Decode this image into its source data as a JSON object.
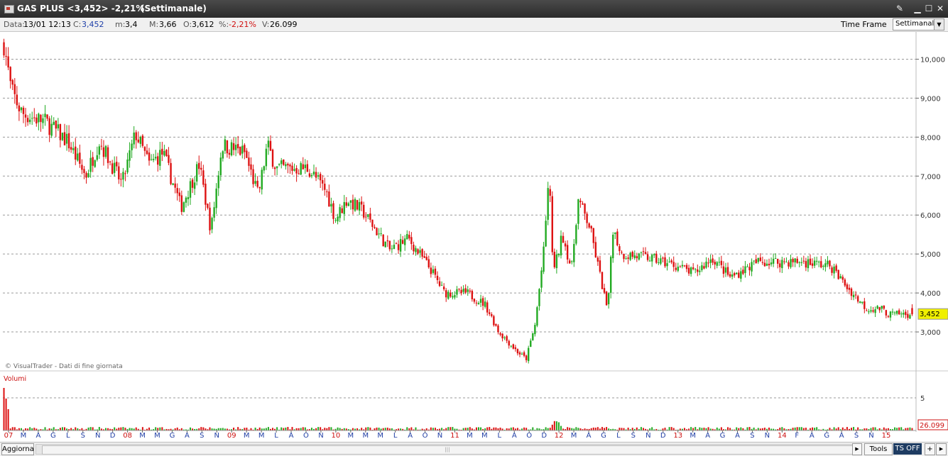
{
  "window": {
    "title": "GAS PLUS <3,452> -2,21%",
    "timeframe_label": "(Settimanale)",
    "controls": [
      "tool-icon",
      "minimize-icon",
      "maximize-icon",
      "close-icon"
    ]
  },
  "infobar": {
    "data_label": "Data:",
    "data_value": "13/01 12:13",
    "c_label": "C:",
    "c_value": "3,452",
    "m_label": "m:",
    "m_value": "3,4",
    "mx_label": "M:",
    "mx_value": "3,66",
    "o_label": "O:",
    "o_value": "3,612",
    "pct_label": "%:",
    "pct_value": "-2,21%",
    "v_label": "V:",
    "v_value": "26.099",
    "time_frame_label": "Time Frame",
    "time_frame_value": "Settimanale"
  },
  "statusbar": {
    "aggiorna": "Aggiorna",
    "tools": "Tools",
    "ts_off": "TS OFF",
    "plus": "+",
    "arrow": "▶"
  },
  "chart_data": {
    "type": "candlestick",
    "price_panel": {
      "yticks": [
        "3,000",
        "4,000",
        "5,000",
        "6,000",
        "7,000",
        "8,000",
        "9,000",
        "10,000"
      ],
      "ytick_values": [
        3,
        4,
        5,
        6,
        7,
        8,
        9,
        10
      ],
      "ylim": [
        2.0,
        10.7
      ],
      "grid": true,
      "last_price_label": "3,452",
      "last_price": 3.452,
      "source_note": "© VisualTrader - Dati di fine giornata"
    },
    "volume_panel": {
      "title": "Volumi",
      "ytick_label": "5",
      "ytick_value": 5,
      "last_volume_label": "26.099"
    },
    "xaxis": {
      "num_bars": 420,
      "labels": [
        {
          "bar": 3,
          "text": "07",
          "year": true
        },
        {
          "bar": 13,
          "text": "M"
        },
        {
          "bar": 22,
          "text": "A"
        },
        {
          "bar": 30,
          "text": "M"
        },
        {
          "bar": 40,
          "text": "G"
        },
        {
          "bar": 48,
          "text": "L"
        },
        {
          "bar": 57,
          "text": "A"
        },
        {
          "bar": 66,
          "text": "S"
        },
        {
          "bar": 74,
          "text": "O"
        },
        {
          "bar": 83,
          "text": "N"
        },
        {
          "bar": 91,
          "text": "D"
        },
        {
          "bar": 96,
          "text": "08",
          "year": true
        },
        {
          "bar": 109,
          "text": "M"
        },
        {
          "bar": 117,
          "text": "A"
        },
        {
          "bar": 126,
          "text": "M"
        },
        {
          "bar": 134,
          "text": "G"
        },
        {
          "bar": 143,
          "text": "L"
        },
        {
          "bar": 151,
          "text": "A"
        },
        {
          "bar": 160,
          "text": "S"
        },
        {
          "bar": 168,
          "text": "O"
        },
        {
          "bar": 177,
          "text": "N"
        },
        {
          "bar": 185,
          "text": "D"
        },
        {
          "bar": 191,
          "text": "09",
          "year": true
        },
        {
          "bar": 203,
          "text": "M"
        },
        {
          "bar": 212,
          "text": "A"
        },
        {
          "bar": 220,
          "text": "M"
        },
        {
          "bar": 229,
          "text": "G"
        },
        {
          "bar": 237,
          "text": "L"
        },
        {
          "bar": 246,
          "text": "A"
        },
        {
          "bar": 254,
          "text": "S"
        },
        {
          "bar": 263,
          "text": "O"
        },
        {
          "bar": 271,
          "text": "N"
        },
        {
          "bar": 280,
          "text": "D"
        },
        {
          "bar": 285,
          "text": "10",
          "year": true
        },
        {
          "bar": 297,
          "text": "M"
        },
        {
          "bar": 306,
          "text": "A"
        },
        {
          "bar": 314,
          "text": "M"
        },
        {
          "bar": 323,
          "text": "G"
        },
        {
          "bar": 331,
          "text": "L"
        },
        {
          "bar": 340,
          "text": "A"
        },
        {
          "bar": 348,
          "text": "S"
        },
        {
          "bar": 357,
          "text": "O"
        },
        {
          "bar": 365,
          "text": "N"
        },
        {
          "bar": 374,
          "text": "D"
        },
        {
          "bar": 379,
          "text": "11",
          "year": true
        },
        {
          "bar": 391,
          "text": "M"
        },
        {
          "bar": 400,
          "text": "A"
        },
        {
          "bar": 408,
          "text": "M"
        },
        {
          "bar": 416,
          "text": "G"
        }
      ],
      "visible_labels_text": "07 M A G L S N D 08 M M G A S N 09 M M L A O N 10 M M M L A O N 11 M M L A O D 12 M A G L S N D 13 M A G A S N 14 F A G A S N 15"
    },
    "price_series_anchors": [
      {
        "t": 0.0,
        "v": 10.4
      },
      {
        "t": 0.008,
        "v": 9.2
      },
      {
        "t": 0.02,
        "v": 8.6
      },
      {
        "t": 0.045,
        "v": 8.4
      },
      {
        "t": 0.07,
        "v": 7.9
      },
      {
        "t": 0.09,
        "v": 7.0
      },
      {
        "t": 0.105,
        "v": 7.9
      },
      {
        "t": 0.13,
        "v": 6.8
      },
      {
        "t": 0.145,
        "v": 8.1
      },
      {
        "t": 0.16,
        "v": 7.3
      },
      {
        "t": 0.175,
        "v": 7.6
      },
      {
        "t": 0.195,
        "v": 6.2
      },
      {
        "t": 0.215,
        "v": 7.3
      },
      {
        "t": 0.228,
        "v": 5.6
      },
      {
        "t": 0.24,
        "v": 7.8
      },
      {
        "t": 0.265,
        "v": 7.6
      },
      {
        "t": 0.28,
        "v": 6.5
      },
      {
        "t": 0.29,
        "v": 7.8
      },
      {
        "t": 0.3,
        "v": 7.2
      },
      {
        "t": 0.335,
        "v": 7.2
      },
      {
        "t": 0.355,
        "v": 6.6
      },
      {
        "t": 0.365,
        "v": 5.9
      },
      {
        "t": 0.378,
        "v": 6.4
      },
      {
        "t": 0.395,
        "v": 6.1
      },
      {
        "t": 0.41,
        "v": 5.6
      },
      {
        "t": 0.425,
        "v": 5.1
      },
      {
        "t": 0.445,
        "v": 5.4
      },
      {
        "t": 0.47,
        "v": 4.6
      },
      {
        "t": 0.485,
        "v": 4.0
      },
      {
        "t": 0.51,
        "v": 4.0
      },
      {
        "t": 0.53,
        "v": 3.7
      },
      {
        "t": 0.545,
        "v": 3.0
      },
      {
        "t": 0.565,
        "v": 2.5
      },
      {
        "t": 0.575,
        "v": 2.3
      },
      {
        "t": 0.585,
        "v": 3.2
      },
      {
        "t": 0.595,
        "v": 5.2
      },
      {
        "t": 0.6,
        "v": 7.1
      },
      {
        "t": 0.605,
        "v": 4.5
      },
      {
        "t": 0.615,
        "v": 5.5
      },
      {
        "t": 0.625,
        "v": 4.6
      },
      {
        "t": 0.632,
        "v": 6.4
      },
      {
        "t": 0.645,
        "v": 5.7
      },
      {
        "t": 0.655,
        "v": 4.6
      },
      {
        "t": 0.665,
        "v": 3.5
      },
      {
        "t": 0.67,
        "v": 5.7
      },
      {
        "t": 0.68,
        "v": 5.0
      },
      {
        "t": 0.71,
        "v": 4.9
      },
      {
        "t": 0.74,
        "v": 4.7
      },
      {
        "t": 0.76,
        "v": 4.5
      },
      {
        "t": 0.78,
        "v": 4.9
      },
      {
        "t": 0.8,
        "v": 4.4
      },
      {
        "t": 0.83,
        "v": 4.8
      },
      {
        "t": 0.86,
        "v": 4.8
      },
      {
        "t": 0.88,
        "v": 4.8
      },
      {
        "t": 0.91,
        "v": 4.7
      },
      {
        "t": 0.93,
        "v": 4.1
      },
      {
        "t": 0.95,
        "v": 3.6
      },
      {
        "t": 0.965,
        "v": 3.6
      },
      {
        "t": 0.975,
        "v": 3.45
      },
      {
        "t": 1.0,
        "v": 3.452
      }
    ],
    "colors": {
      "up": "#22aa22",
      "down": "#dd1111",
      "grid": "#9a9a9a",
      "axis_month": "#2240a6",
      "axis_year": "#cc1111",
      "price_box": "#f0f000"
    }
  }
}
